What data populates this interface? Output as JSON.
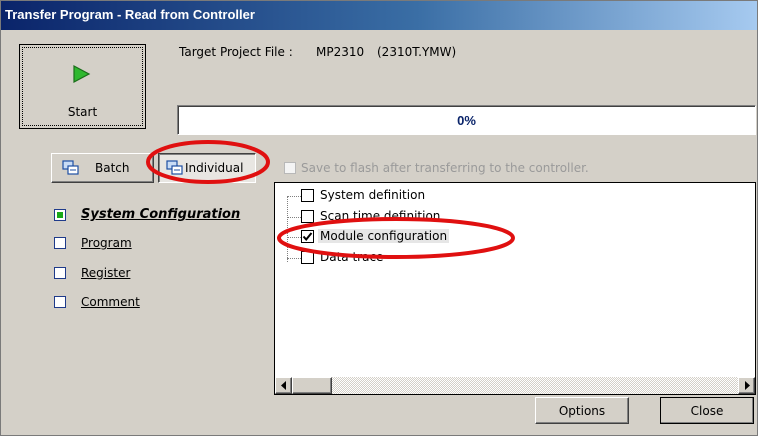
{
  "window": {
    "title": "Transfer Program - Read from Controller"
  },
  "start_button": {
    "label": "Start"
  },
  "target": {
    "label": "Target Project File :",
    "project": "MP2310",
    "file": "(2310T.YMW)"
  },
  "progress": {
    "value": 0,
    "text": "0%"
  },
  "mode_buttons": {
    "batch_label": "Batch",
    "individual_label": "Individual"
  },
  "save_flash": {
    "label": "Save to flash after transferring to the controller.",
    "checked": false,
    "enabled": false
  },
  "sidebar": {
    "items": [
      {
        "label": "System Configuration",
        "checked": true
      },
      {
        "label": "Program",
        "checked": false
      },
      {
        "label": "Register",
        "checked": false
      },
      {
        "label": "Comment",
        "checked": false
      }
    ]
  },
  "tree": {
    "items": [
      {
        "label": "System definition",
        "checked": false
      },
      {
        "label": "Scan time definition",
        "checked": false
      },
      {
        "label": "Module configuration",
        "checked": true
      },
      {
        "label": "Data trace",
        "checked": false
      }
    ]
  },
  "footer": {
    "options_label": "Options",
    "close_label": "Close"
  },
  "colors": {
    "title_bar": "#0a246a",
    "annotation_red": "#e01010",
    "start_icon_green": "#2fb82f"
  }
}
